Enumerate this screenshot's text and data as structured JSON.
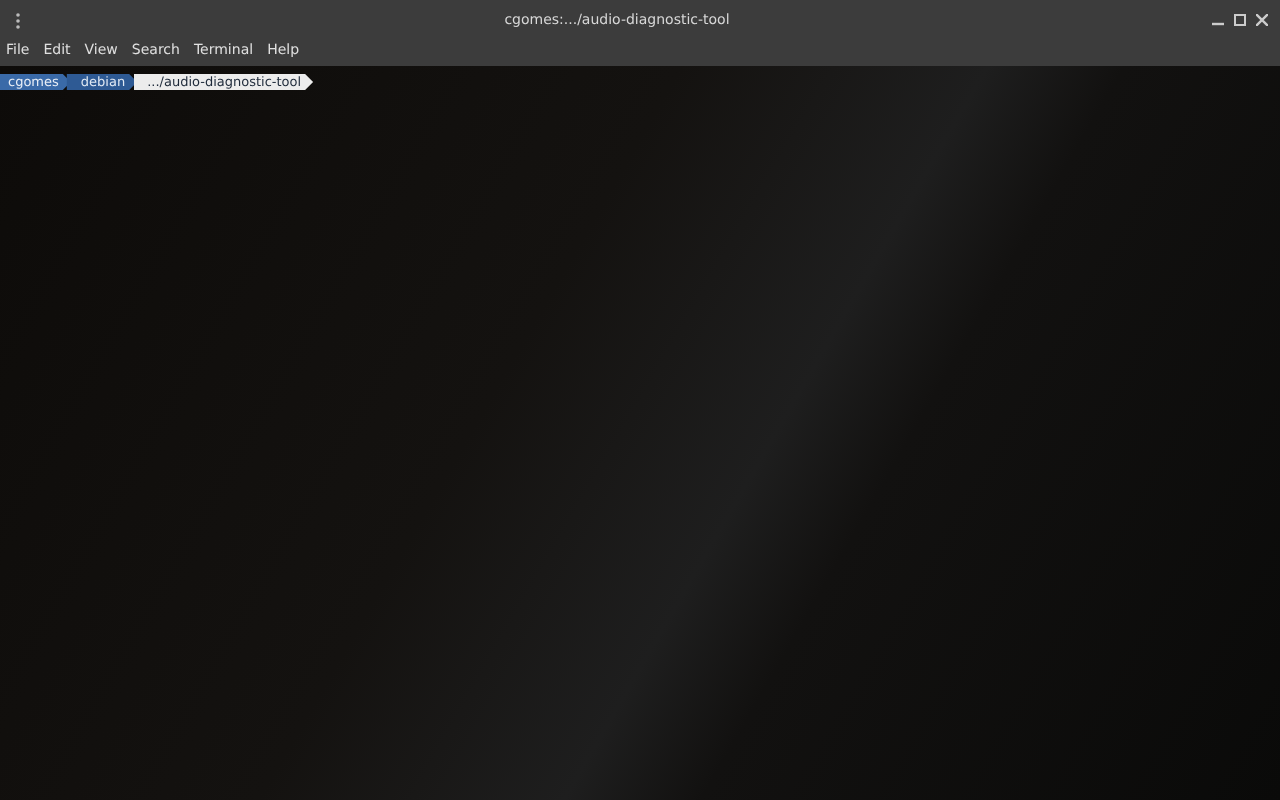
{
  "window": {
    "title": "cgomes:.../audio-diagnostic-tool"
  },
  "menu": [
    "File",
    "Edit",
    "View",
    "Search",
    "Terminal",
    "Help"
  ],
  "prompt": [
    {
      "text": "cgomes",
      "kind": "user"
    },
    {
      "text": "debian",
      "kind": "host"
    },
    {
      "text": ".../audio-diagnostic-tool",
      "kind": "path"
    }
  ]
}
